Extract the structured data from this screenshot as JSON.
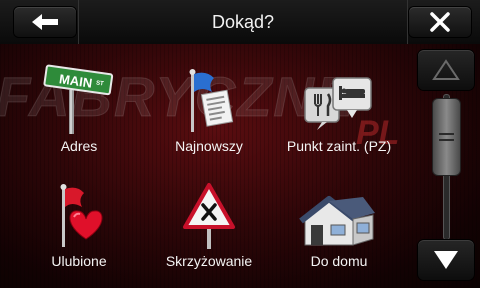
{
  "header": {
    "title": "Dokąd?",
    "back_icon": "arrow-left-icon",
    "close_icon": "close-icon"
  },
  "watermark": {
    "text": "FABRYCZNE",
    "suffix": "PL"
  },
  "menu": {
    "items": [
      {
        "id": "address",
        "label": "Adres",
        "icon": "street-sign-icon",
        "sign_text": "MAIN",
        "sign_suffix": "ST"
      },
      {
        "id": "recent",
        "label": "Najnowszy",
        "icon": "recent-flag-icon"
      },
      {
        "id": "poi",
        "label": "Punkt zaint. (PZ)",
        "icon": "poi-icon"
      },
      {
        "id": "favorites",
        "label": "Ulubione",
        "icon": "heart-flag-icon"
      },
      {
        "id": "intersection",
        "label": "Skrzyżowanie",
        "icon": "intersection-sign-icon"
      },
      {
        "id": "home",
        "label": "Do domu",
        "icon": "house-icon"
      }
    ]
  },
  "scrollbar": {
    "up_icon": "triangle-up-icon",
    "down_icon": "triangle-down-icon",
    "position": 0.0
  },
  "colors": {
    "background": "#2e0608",
    "accent": "#f2f2f2",
    "heart": "#e0102a",
    "sign_green": "#2e8b3a"
  }
}
